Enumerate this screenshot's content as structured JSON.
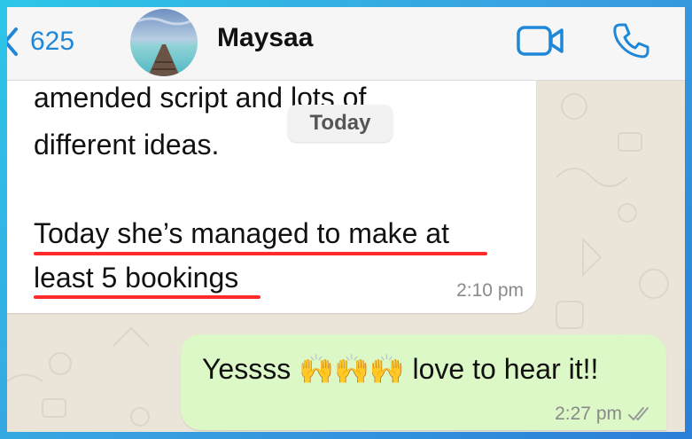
{
  "header": {
    "back_count": "625",
    "contact_name": "Maysaa"
  },
  "day_separator": "Today",
  "incoming": {
    "line1": "amended script and lots of",
    "line2": "different ideas.",
    "line3": "Today she’s managed to make at",
    "line4": "least 5 bookings",
    "time": "2:10 pm"
  },
  "outgoing": {
    "text": "Yessss 🙌🙌🙌 love to hear it!!",
    "time": "2:27 pm",
    "status": "read"
  },
  "colors": {
    "accent": "#1f87d8",
    "outgoing_bubble": "#dcf8c6",
    "underline": "#ff2a2a"
  }
}
